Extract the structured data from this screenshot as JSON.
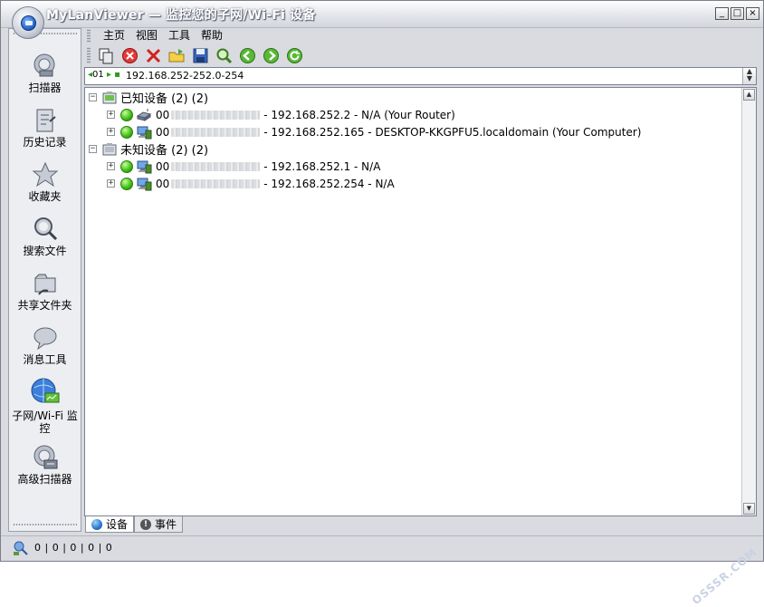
{
  "window": {
    "title": "MyLanViewer — 监控您的子网/Wi-Fi 设备",
    "controls": [
      "_",
      "□",
      "×"
    ]
  },
  "sidebar": {
    "items": [
      {
        "label": "扫描器",
        "icon": "scanner-icon"
      },
      {
        "label": "历史记录",
        "icon": "history-icon"
      },
      {
        "label": "收藏夹",
        "icon": "star-icon"
      },
      {
        "label": "搜索文件",
        "icon": "search-files-icon"
      },
      {
        "label": "共享文件夹",
        "icon": "shared-folder-icon"
      },
      {
        "label": "消息工具",
        "icon": "message-icon"
      },
      {
        "label": "子网/Wi-Fi 监控",
        "icon": "subnet-monitor-icon"
      },
      {
        "label": "高级扫描器",
        "icon": "advanced-scanner-icon"
      }
    ]
  },
  "menu": {
    "items": [
      "主页",
      "视图",
      "工具",
      "帮助"
    ]
  },
  "toolbar": {
    "buttons": [
      "copy-icon",
      "stop-icon",
      "delete-icon",
      "open-folder-icon",
      "save-icon",
      "find-icon",
      "back-icon",
      "forward-icon",
      "refresh-icon"
    ]
  },
  "address": {
    "prefix": "01",
    "value": "192.168.252-252.0-254"
  },
  "tree": {
    "groups": [
      {
        "label": "已知设备 (2) (2)",
        "expander": "−",
        "devices": [
          {
            "prefix": "00",
            "text": "- 192.168.252.2 - N/A (Your Router)",
            "expander": "+"
          },
          {
            "prefix": "00",
            "text": "- 192.168.252.165 - DESKTOP-KKGPFU5.localdomain (Your Computer)",
            "expander": "+"
          }
        ]
      },
      {
        "label": "未知设备 (2) (2)",
        "expander": "−",
        "devices": [
          {
            "prefix": "00",
            "text": "- 192.168.252.1 - N/A",
            "expander": "+"
          },
          {
            "prefix": "00",
            "text": "- 192.168.252.254 - N/A",
            "expander": "+"
          }
        ]
      }
    ]
  },
  "tabs": [
    {
      "label": "设备",
      "active": true
    },
    {
      "label": "事件",
      "active": false
    }
  ],
  "status": {
    "counts": "0 | 0 | 0 | 0 | 0"
  },
  "watermark": "OSSSR.COM",
  "colors": {
    "title_text": "#ffffff",
    "status_green": "#45c21a",
    "delete_red": "#d22020"
  }
}
